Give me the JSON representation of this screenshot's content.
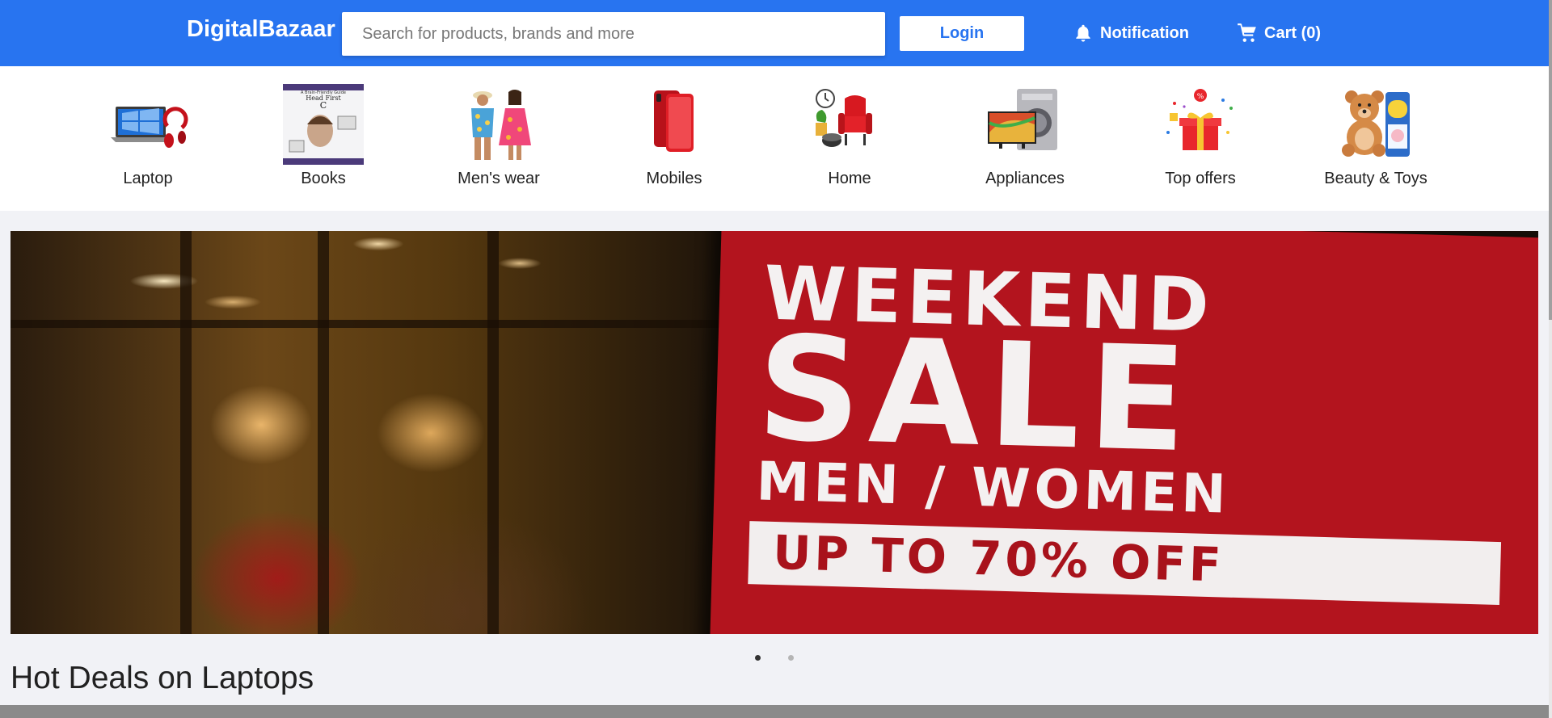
{
  "header": {
    "logo": "DigitalBazaar",
    "search_placeholder": "Search for products, brands and more",
    "login_label": "Login",
    "notification_label": "Notification",
    "cart_label": "Cart (0)",
    "bg_color": "#2874f0"
  },
  "categories": [
    {
      "label": "Laptop",
      "icon": "laptop-icon"
    },
    {
      "label": "Books",
      "icon": "book-icon"
    },
    {
      "label": "Men's wear",
      "icon": "clothing-icon"
    },
    {
      "label": "Mobiles",
      "icon": "mobile-icon"
    },
    {
      "label": "Home",
      "icon": "home-furniture-icon"
    },
    {
      "label": "Appliances",
      "icon": "appliance-icon"
    },
    {
      "label": "Top offers",
      "icon": "gift-icon"
    },
    {
      "label": "Beauty & Toys",
      "icon": "teddy-bear-icon"
    }
  ],
  "banner": {
    "line1": "WEEKEND",
    "line2": "SALE",
    "line3": "MEN / WOMEN",
    "line4": "UP TO 70% OFF",
    "book_cover_top": "A Brain-Friendly Guide",
    "book_cover_title": "Head First",
    "book_cover_sub": "C",
    "offer_badge": "%",
    "slide_count": 2,
    "active_slide": 1
  },
  "section": {
    "title": "Hot Deals on Laptops"
  }
}
